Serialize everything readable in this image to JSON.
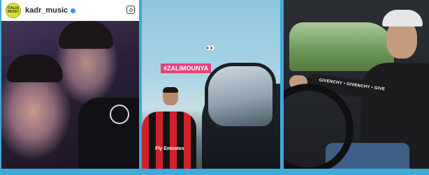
{
  "colors": {
    "background": "#3fa9d8",
    "sticker": "#e4447a",
    "verified": "#3897f0"
  },
  "panel_1": {
    "header": {
      "avatar_text": "ITALIA MUSIC",
      "username": "kadr_music",
      "verified_icon": "verified-badge-icon",
      "menu_icon": "instagram-icon"
    }
  },
  "panel_2": {
    "sticker": "#ZALIMOUNYA",
    "emoji": "👀",
    "jersey_text": "Fly Emirates"
  },
  "panel_3": {
    "sleeve_text": "GIVENCHY • GIVENCHY • GIVE"
  }
}
